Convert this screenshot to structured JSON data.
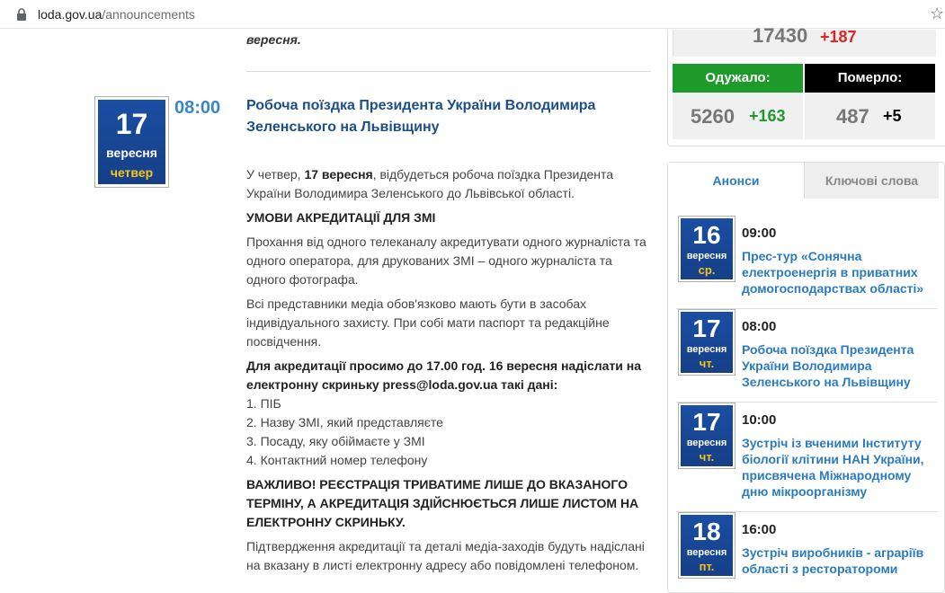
{
  "browser": {
    "url_domain": "loda.gov.ua",
    "url_path": "/announcements",
    "lock_icon": "lock-icon",
    "bookmark_icon": "star-icon"
  },
  "article_prev_tail": "вересня.",
  "article": {
    "day": "17",
    "month": "вересня",
    "weekday": "четвер",
    "time": "08:00",
    "title": "Робоча поїздка Президента України Володимира Зеленського на Львівщину",
    "p1_pre": "У четвер, ",
    "p1_bold": "17 вересня",
    "p1_post": ", відбудеться робоча поїздка Президента України Володимира Зеленського до Львівської області.",
    "h_conditions": "УМОВИ АКРЕДИТАЦІЇ ДЛЯ ЗМІ",
    "p2": "Прохання від одного телеканалу акредитувати одного журналіста та одного оператора, для друкованих ЗМІ – одного журналіста та одного фотографа.",
    "p3": "Всі представники медіа обов'язково мають бути в засобах індивідуального захисту. При собі мати паспорт та редакційне посвідчення.",
    "p4_bold": "Для акредитації просимо до 17.00 год. 16 вересня надіслати на електронну скриньку press@loda.gov.ua такі дані:",
    "list": [
      "1. ПІБ",
      "2. Назву ЗМІ, який представляєте",
      "3. Посаду, яку обіймаєте у ЗМІ",
      "4. Контактний номер телефону"
    ],
    "important": "ВАЖЛИВО! РЕЄСТРАЦІЯ ТРИВАТИМЕ ЛИШЕ ДО ВКАЗАНОГО ТЕРМІНУ, А АКРЕДИТАЦІЯ ЗДІЙСНЮЄТЬСЯ ЛИШЕ ЛИСТОМ НА ЕЛЕКТРОННУ СКРИНЬКУ.",
    "p_last": "Підтвердження акредитації та деталі медіа-заходів будуть надіслані на вказану в листі електронну адресу або повідомлені телефоном."
  },
  "stats": {
    "top_value": "17430",
    "top_delta": "+187",
    "recovered_label": "Одужало:",
    "recovered_value": "5260",
    "recovered_delta": "+163",
    "died_label": "Померло:",
    "died_value": "487",
    "died_delta": "+5",
    "colors": {
      "recovered": "#1e9a2a",
      "died": "#000000",
      "top_delta": "#e02424"
    }
  },
  "tabs": {
    "announcements": "Анонси",
    "keywords": "Ключові слова"
  },
  "announcements": [
    {
      "day": "16",
      "month": "вересня",
      "weekday": "ср.",
      "time": "09:00",
      "title": "Прес-тур «Сонячна електроенергія в приватних домогосподарствах області»"
    },
    {
      "day": "17",
      "month": "вересня",
      "weekday": "чт.",
      "time": "08:00",
      "title": "Робоча поїздка Президента України Володимира Зеленського на Львівщину"
    },
    {
      "day": "17",
      "month": "вересня",
      "weekday": "чт.",
      "time": "10:00",
      "title": "Зустріч із вченими Інституту біології клітини НАН України, присвячена Міжнародному дню мікроорганізму"
    },
    {
      "day": "18",
      "month": "вересня",
      "weekday": "пт.",
      "time": "16:00",
      "title": "Зустріч виробників - аграріїв області з ресторатороми"
    }
  ]
}
